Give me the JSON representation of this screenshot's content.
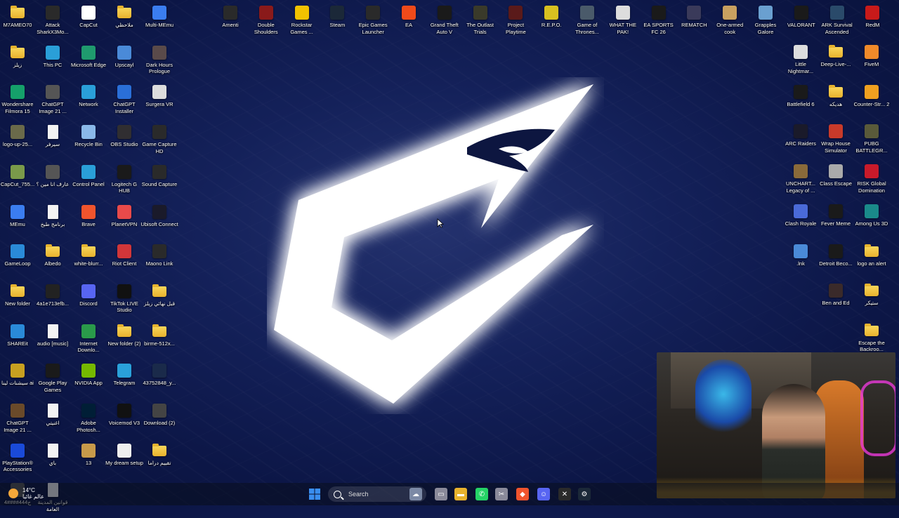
{
  "left_icons": [
    {
      "label": "M7AMEO70",
      "type": "folder",
      "color": "#e8b22d"
    },
    {
      "label": "Attack SharkX3Mo...",
      "type": "app",
      "color": "#2a2a2a"
    },
    {
      "label": "CapCut",
      "type": "app",
      "color": "#ffffff"
    },
    {
      "label": "ملاحظي",
      "type": "folder",
      "color": "#e8b22d"
    },
    {
      "label": "Multi-MEmu",
      "type": "app",
      "color": "#3b7df0"
    },
    {
      "label": "زيلز",
      "type": "folder",
      "color": "#e8b22d"
    },
    {
      "label": "This PC",
      "type": "app",
      "color": "#2a9fd8"
    },
    {
      "label": "Microsoft Edge",
      "type": "app",
      "color": "#1f9a6e"
    },
    {
      "label": "Upscayl",
      "type": "app",
      "color": "#4a8ad8"
    },
    {
      "label": "Dark Hours Prologue",
      "type": "app",
      "color": "#5a4a4a"
    },
    {
      "label": "Wondershare Filmora 15",
      "type": "app",
      "color": "#15a06a"
    },
    {
      "label": "ChatGPT Image 21 ...",
      "type": "app",
      "color": "#555555"
    },
    {
      "label": "Network",
      "type": "app",
      "color": "#2a9fd8"
    },
    {
      "label": "ChatGPT Installer",
      "type": "app",
      "color": "#2a6fd8"
    },
    {
      "label": "Surgera VR",
      "type": "app",
      "color": "#dddddd"
    },
    {
      "label": "logo-up-25...",
      "type": "app",
      "color": "#6a6a4a"
    },
    {
      "label": "سيرفر",
      "type": "doc",
      "color": "#f3f3f3"
    },
    {
      "label": "Recycle Bin",
      "type": "app",
      "color": "#8ab8e8"
    },
    {
      "label": "OBS Studio",
      "type": "app",
      "color": "#302e31"
    },
    {
      "label": "Game Capture HD",
      "type": "app",
      "color": "#2a2a2a"
    },
    {
      "label": "CapCut_755...",
      "type": "app",
      "color": "#7a9a4a"
    },
    {
      "label": "عارف انا مين ؟",
      "type": "app",
      "color": "#555555"
    },
    {
      "label": "Control Panel",
      "type": "app",
      "color": "#2a9fd8"
    },
    {
      "label": "Logitech G HUB",
      "type": "app",
      "color": "#1a1a1a"
    },
    {
      "label": "Sound Capture",
      "type": "app",
      "color": "#2a2a2a"
    },
    {
      "label": "MEmu",
      "type": "app",
      "color": "#3b7df0"
    },
    {
      "label": "برنامج طبخ",
      "type": "doc",
      "color": "#f3f3f3"
    },
    {
      "label": "Brave",
      "type": "app",
      "color": "#f0542d"
    },
    {
      "label": "PlanetVPN",
      "type": "app",
      "color": "#e84a4a"
    },
    {
      "label": "Ubisoft Connect",
      "type": "app",
      "color": "#1a1a2a"
    },
    {
      "label": "GameLoop",
      "type": "app",
      "color": "#2a8ad8"
    },
    {
      "label": "Albedo",
      "type": "folder",
      "color": "#e8b22d"
    },
    {
      "label": "white-blurr...",
      "type": "folder",
      "color": "#e8b22d"
    },
    {
      "label": "Riot Client",
      "type": "app",
      "color": "#d13639"
    },
    {
      "label": "Maono Link",
      "type": "app",
      "color": "#2a2a2a"
    },
    {
      "label": "New folder",
      "type": "folder",
      "color": "#e8b22d"
    },
    {
      "label": "4a1e713efb...",
      "type": "app",
      "color": "#222222"
    },
    {
      "label": "Discord",
      "type": "app",
      "color": "#5865f2"
    },
    {
      "label": "TikTok LIVE Studio",
      "type": "app",
      "color": "#111111"
    },
    {
      "label": "قبل نهائي زيلز",
      "type": "folder",
      "color": "#e8b22d"
    },
    {
      "label": "SHAREit",
      "type": "app",
      "color": "#2a8ad8"
    },
    {
      "label": "audio [music]",
      "type": "doc",
      "color": "#f3f3f3"
    },
    {
      "label": "Internet Downlo...",
      "type": "app",
      "color": "#2a9a4a"
    },
    {
      "label": "New folder (2)",
      "type": "folder",
      "color": "#e8b22d"
    },
    {
      "label": "birme-512x...",
      "type": "folder",
      "color": "#e8b22d"
    },
    {
      "label": "سيشنات لينا ai",
      "type": "app",
      "color": "#c8a020"
    },
    {
      "label": "Google Play Games",
      "type": "app",
      "color": "#1a1a1a"
    },
    {
      "label": "NVIDIA App",
      "type": "app",
      "color": "#76b900"
    },
    {
      "label": "Telegram",
      "type": "app",
      "color": "#2aa1da"
    },
    {
      "label": "43752848_y...",
      "type": "app",
      "color": "#1a2a4a"
    },
    {
      "label": "ChatGPT Image 21 ...",
      "type": "app",
      "color": "#6a4a2a"
    },
    {
      "label": "اغنيتي",
      "type": "doc",
      "color": "#f3f3f3"
    },
    {
      "label": "Adobe Photosh...",
      "type": "app",
      "color": "#001e36"
    },
    {
      "label": "Voicemod V3",
      "type": "app",
      "color": "#111111"
    },
    {
      "label": "Download (2)",
      "type": "app",
      "color": "#444444"
    },
    {
      "label": "PlayStation® Accessories",
      "type": "app",
      "color": "#1a4ad8"
    },
    {
      "label": "باي",
      "type": "doc",
      "color": "#f3f3f3"
    },
    {
      "label": "13",
      "type": "app",
      "color": "#c89a4a"
    },
    {
      "label": "My dream setup",
      "type": "app",
      "color": "#eeeeee"
    },
    {
      "label": "تقييم دراما",
      "type": "folder",
      "color": "#e8b22d"
    },
    {
      "label": "4####444ج",
      "type": "app",
      "color": "#555555"
    },
    {
      "label": "قوانين المدينة العامة",
      "type": "doc",
      "color": "#f3f3f3"
    }
  ],
  "top_icons": [
    {
      "label": "Amenti",
      "color": "#2a2a2a"
    },
    {
      "label": "Double Shoulders",
      "color": "#8a1a1a"
    },
    {
      "label": "Rockstar Games ...",
      "color": "#f2c200"
    },
    {
      "label": "Steam",
      "color": "#1b2838"
    },
    {
      "label": "Epic Games Launcher",
      "color": "#2a2a2a"
    },
    {
      "label": "EA",
      "color": "#f04a1a"
    },
    {
      "label": "Grand Theft Auto V",
      "color": "#1a1a1a"
    },
    {
      "label": "The Outlast Trials",
      "color": "#3a3a2a"
    },
    {
      "label": "Project Playtime",
      "color": "#5a1a1a"
    },
    {
      "label": "R.E.P.O.",
      "color": "#d8c020"
    },
    {
      "label": "Game of Thrones...",
      "color": "#4a5a6a"
    },
    {
      "label": "WHAT THE PAK!",
      "color": "#dddddd"
    },
    {
      "label": "EA SPORTS FC 26",
      "color": "#1a1a1a"
    },
    {
      "label": "REMATCH",
      "color": "#3a3a5a"
    },
    {
      "label": "One-armed cook",
      "color": "#c8a060"
    },
    {
      "label": "Grapples Galore",
      "color": "#6aa0d0"
    },
    {
      "label": "VALORANT",
      "color": "#1a1a1a"
    },
    {
      "label": "ARK Survival Ascended",
      "color": "#2a4a6a"
    },
    {
      "label": "RedM",
      "color": "#c81a1a"
    }
  ],
  "right_icons": [
    {
      "label": "Little Nightmar...",
      "type": "app",
      "color": "#dddddd"
    },
    {
      "label": "Deep-Live-...",
      "type": "folder",
      "color": "#e8b22d"
    },
    {
      "label": "FiveM",
      "type": "app",
      "color": "#f08a2a"
    },
    {
      "label": "Battlefield 6",
      "type": "app",
      "color": "#1a1a1a"
    },
    {
      "label": "هديكه",
      "type": "folder",
      "color": "#e8b22d"
    },
    {
      "label": "Counter-Str... 2",
      "type": "app",
      "color": "#f0a020"
    },
    {
      "label": "ARC Raiders",
      "type": "app",
      "color": "#1a1a2a"
    },
    {
      "label": "Wrap House Simulator",
      "type": "app",
      "color": "#c83a2a"
    },
    {
      "label": "PUBG BATTLEGR...",
      "type": "app",
      "color": "#5a5a3a"
    },
    {
      "label": "UNCHART... Legacy of ...",
      "type": "app",
      "color": "#8a6a3a"
    },
    {
      "label": "Class Escape",
      "type": "app",
      "color": "#aaaaaa"
    },
    {
      "label": "RISK Global Domination",
      "type": "app",
      "color": "#c81a2a"
    },
    {
      "label": "Clash Royale",
      "type": "app",
      "color": "#4a6ad8"
    },
    {
      "label": "Fever Meme",
      "type": "app",
      "color": "#1a1a1a"
    },
    {
      "label": "Among Us 3D",
      "type": "app",
      "color": "#1a8a8a"
    },
    {
      "label": ".lnk",
      "type": "app",
      "color": "#4a8ad8"
    },
    {
      "label": "Detroit Beco...",
      "type": "app",
      "color": "#1a1a1a"
    },
    {
      "label": "logo an alert",
      "type": "folder",
      "color": "#e8b22d"
    },
    {
      "label": "Ben and Ed",
      "type": "app",
      "color": "#3a2a2a"
    },
    {
      "label": "ستيكر",
      "type": "folder",
      "color": "#e8b22d"
    },
    {
      "label": "Escape the Backroo...",
      "type": "folder",
      "color": "#e8b22d"
    }
  ],
  "taskbar": {
    "weather_temp": "14°C",
    "weather_desc": "عالم غائيا",
    "search_placeholder": "Search",
    "apps": [
      {
        "name": "start-button",
        "color": "#3a8ef0",
        "glyph": "⊞"
      },
      {
        "name": "widgets-icon",
        "color": "#6a7a9a",
        "glyph": "☁"
      },
      {
        "name": "task-view-icon",
        "color": "#8a8a9a",
        "glyph": "▭"
      },
      {
        "name": "file-explorer-icon",
        "color": "#e8b22d",
        "glyph": "▬"
      },
      {
        "name": "whatsapp-icon",
        "color": "#25d366",
        "glyph": "✆"
      },
      {
        "name": "snipping-tool-icon",
        "color": "#8a8a9a",
        "glyph": "✂"
      },
      {
        "name": "brave-icon",
        "color": "#f0542d",
        "glyph": "◆"
      },
      {
        "name": "discord-icon",
        "color": "#5865f2",
        "glyph": "☺"
      },
      {
        "name": "capcut-icon",
        "color": "#2a2a2a",
        "glyph": "✕"
      },
      {
        "name": "steam-icon",
        "color": "#1b2838",
        "glyph": "⚙"
      }
    ]
  }
}
